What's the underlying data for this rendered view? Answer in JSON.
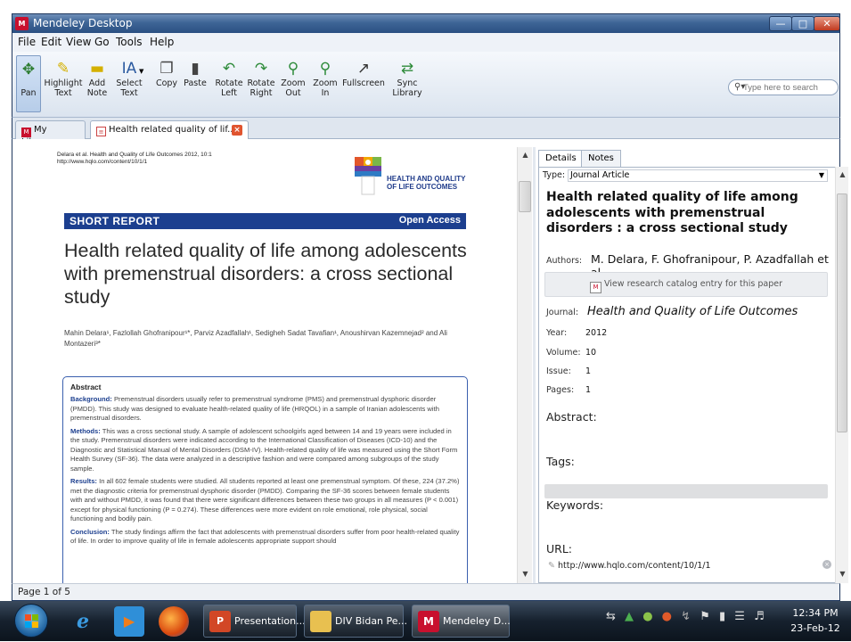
{
  "window": {
    "title": "Mendeley Desktop",
    "icon_text": "M"
  },
  "menu": [
    "File",
    "Edit",
    "View",
    "Go",
    "Tools",
    "Help"
  ],
  "toolbar": {
    "pan": "Pan",
    "highlight": "Highlight\nText",
    "add_note": "Add\nNote",
    "select": "Select\nText",
    "copy": "Copy",
    "paste": "Paste",
    "rotate_left": "Rotate\nLeft",
    "rotate_right": "Rotate\nRight",
    "zoom_out": "Zoom\nOut",
    "zoom_in": "Zoom\nIn",
    "fullscreen": "Fullscreen",
    "sync": "Sync\nLibrary"
  },
  "search": {
    "placeholder": "Type here to search"
  },
  "tabs": {
    "library": "My Library",
    "paper": "Health related quality of lif..."
  },
  "pdf": {
    "citation_line1": "Delara et al. Health and Quality of Life Outcomes 2012, 10:1",
    "citation_line2": "http://www.hqlo.com/content/10/1/1",
    "logo_line1": "HEALTH AND QUALITY",
    "logo_line2": "OF LIFE OUTCOMES",
    "banner_left": "SHORT REPORT",
    "banner_right": "Open Access",
    "title": "Health related quality of life among adolescents with premenstrual disorders: a cross sectional study",
    "authors": "Mahin Delara¹, Fazlollah Ghofranipour¹*, Parviz Azadfallah¹, Sedigheh Sadat Tavafian¹, Anoushirvan Kazemnejad² and Ali Montazeri³*",
    "abstract_head": "Abstract",
    "background_label": "Background:",
    "background": "Premenstrual disorders usually refer to premenstrual syndrome (PMS) and premenstrual dysphoric disorder (PMDD). This study was designed to evaluate health-related quality of life (HRQOL) in a sample of Iranian adolescents with premenstrual disorders.",
    "methods_label": "Methods:",
    "methods": "This was a cross sectional study. A sample of adolescent schoolgirls aged between 14 and 19 years were included in the study. Premenstrual disorders were indicated according to the International Classification of Diseases (ICD-10) and the Diagnostic and Statistical Manual of Mental Disorders (DSM-IV). Health-related quality of life was measured using the Short Form Health Survey (SF-36). The data were analyzed in a descriptive fashion and were compared among subgroups of the study sample.",
    "results_label": "Results:",
    "results": "In all 602 female students were studied. All students reported at least one premenstrual symptom. Of these, 224 (37.2%) met the diagnostic criteria for premenstrual dysphoric disorder (PMDD). Comparing the SF-36 scores between female students with and without PMDD, it was found that there were significant differences between these two groups in all measures (P < 0.001) except for physical functioning (P = 0.274). These differences were more evident on role emotional, role physical, social functioning and bodily pain.",
    "conclusion_label": "Conclusion:",
    "conclusion": "The study findings affirm the fact that adolescents with premenstrual disorders suffer from poor health-related quality of life. In order to improve quality of life in female adolescents appropriate support should"
  },
  "details": {
    "tab_details": "Details",
    "tab_notes": "Notes",
    "type_label": "Type:",
    "type_value": "Journal Article",
    "title": "Health related quality of life among adolescents with premenstrual disorders : a cross sectional study",
    "authors_label": "Authors:",
    "authors_value": "M. Delara, F. Ghofranipour, P. Azadfallah et al.",
    "catalog_link": "View research catalog entry for this paper",
    "journal_label": "Journal:",
    "journal_value": "Health and Quality of Life Outcomes",
    "year_label": "Year:",
    "year_value": "2012",
    "volume_label": "Volume:",
    "volume_value": "10",
    "issue_label": "Issue:",
    "issue_value": "1",
    "pages_label": "Pages:",
    "pages_value": "1",
    "abstract_label": "Abstract:",
    "tags_label": "Tags:",
    "keywords_label": "Keywords:",
    "url_label": "URL:",
    "url_value": "http://www.hqlo.com/content/10/1/1"
  },
  "status": {
    "page": "Page 1 of 5"
  },
  "taskbar": {
    "presentation": "Presentation...",
    "folder": "DIV Bidan Pe...",
    "mendeley": "Mendeley D...",
    "time": "12:34 PM",
    "date": "23-Feb-12"
  },
  "colors": {
    "brand_red": "#c8102e",
    "journal_blue": "#1c3f8f"
  }
}
